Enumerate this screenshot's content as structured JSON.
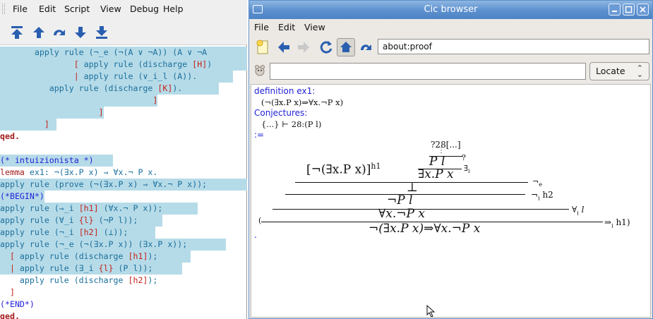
{
  "left_window": {
    "menu": [
      "File",
      "Edit",
      "Script",
      "View",
      "Debug",
      "Help"
    ],
    "toolbar_icons": [
      "goto-top-icon",
      "step-up-icon",
      "goto-cursor-icon",
      "step-down-icon",
      "goto-bottom-icon"
    ],
    "code_lines": [
      {
        "t1": "       apply rule (¬_e (¬(A ∨ ¬A)) (A ∨ ¬A"
      },
      {
        "t1": "               ",
        "b1": "[",
        "t2": " apply rule (discharge ",
        "b2": "[H]",
        "t3": ")"
      },
      {
        "t1": "               ",
        "b1": "|",
        "t2": " apply rule (∨_i_l (A))."
      },
      {
        "t1": "          apply rule (discharge ",
        "b1": "[K]",
        "t2": ")."
      },
      {
        "t1": "                               ",
        "b1": "]"
      },
      {
        "t1": "                    ",
        "b1": "]"
      },
      {
        "t1": "         ",
        "b1": "]"
      },
      {
        "qed": "qed."
      },
      {
        "t1": ""
      },
      {
        "comment": "(* intuizionista *)"
      },
      {
        "kw": "lemma",
        "t1": " ex1: ¬(∃x.P x) ⇒ ∀x.¬ P x."
      },
      {
        "t1": "apply rule (prove (¬(∃x.P x) ⇒ ∀x.¬ P x));"
      },
      {
        "comment": "(*BEGIN*)"
      },
      {
        "t1": "apply rule (⇒_i ",
        "b1": "[h1]",
        "t2": " (∀x.¬ P x));"
      },
      {
        "t1": "apply rule (∀_i ",
        "b1": "{l}",
        "t2": " (¬P l));"
      },
      {
        "t1": "apply rule (¬_i ",
        "b1": "[h2]",
        "t2": " (⊥));"
      },
      {
        "t1": "apply rule (¬_e (¬(∃x.P x)) (∃x.P x));"
      },
      {
        "t1": "  ",
        "b1": "[",
        "t2": " apply rule (discharge ",
        "b2": "[h1]",
        "t3": ");"
      },
      {
        "t1": "  ",
        "b1": "|",
        "t2": " apply rule (∃_i ",
        "b2": "{l}",
        "t3": " (P l));"
      },
      {
        "t1": "    apply rule (discharge ",
        "b1": "[h2]",
        "t2": ");"
      },
      {
        "t1": "  ",
        "b1": "]"
      },
      {
        "comment": "(*END*)"
      },
      {
        "qed": "qed."
      }
    ]
  },
  "right_window": {
    "title": "Cic browser",
    "menu": [
      "File",
      "Edit",
      "View"
    ],
    "url": "about:proof",
    "query": "",
    "locate_label": "Locate",
    "content": {
      "def_header": "definition ex1:",
      "def_statement": "(¬(∃x.P x)⇒∀x.¬P x)",
      "conj_header": "Conjectures:",
      "conj_text": "{...}  ⊢ 28:(P l)",
      "assign": ":=",
      "tree": {
        "top_goal": "?28[...]",
        "dots": "⋮",
        "row1_left": "[¬(∃x.P x)]",
        "row1_left_sup": "h1",
        "row1_mid_top": "P l",
        "row1_mid_q": "?",
        "row1_mid_bottom": "∃x.P x",
        "row1_mid_rule": "∃",
        "row1_mid_rule_sub": "i",
        "row2_concl": "⊥",
        "row2_rule": "¬",
        "row2_rule_sub": "e",
        "row3_concl": "¬P l",
        "row3_rule": "¬",
        "row3_rule_sub": "i",
        "row3_rule_label": "h2",
        "row4_concl": "∀x.¬P x",
        "row4_rule": "∀",
        "row4_rule_sub": "i",
        "row4_rule_label": "l",
        "open_paren": "(",
        "final_concl": "¬(∃x.P x)⇒∀x.¬P x",
        "final_rule": "⇒",
        "final_rule_sub": "i",
        "final_rule_label": "h1)",
        "trailing_dot": "."
      }
    }
  },
  "colors": {
    "selection": "#b6dbe8",
    "keyword": "#a51c1c",
    "comment": "#1f1fd6",
    "bracket": "#c4231d",
    "code_text": "#1a6f9c",
    "title_bar": "#5b8fcd"
  }
}
